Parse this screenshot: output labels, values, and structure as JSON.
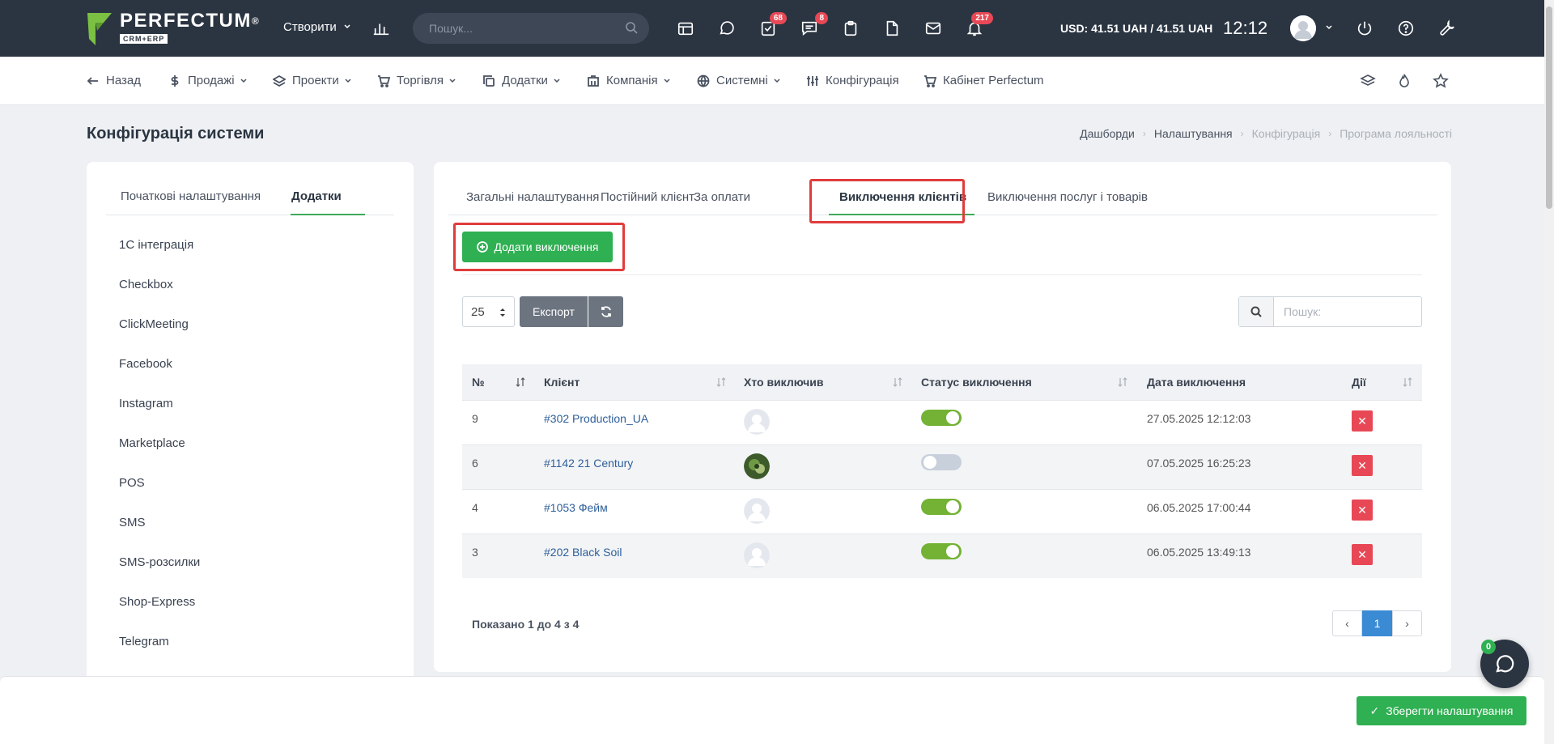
{
  "topbar": {
    "logo_name": "PERFECTUM",
    "logo_reg": "®",
    "logo_sub": "CRM+ERP",
    "create_label": "Створити",
    "search_placeholder": "Пошук...",
    "badges": {
      "tasks": "68",
      "messages": "8",
      "notifications": "217"
    },
    "currency": "USD: 41.51 UAH / 41.51 UAH",
    "time": "12:12"
  },
  "nav": {
    "back": "Назад",
    "sales": "Продажі",
    "projects": "Проекти",
    "trade": "Торгівля",
    "addons": "Додатки",
    "company": "Компанія",
    "system": "Системні",
    "config": "Конфігурація",
    "cabinet": "Кабінет Perfectum"
  },
  "page": {
    "title": "Конфігурація системи",
    "breadcrumb": [
      "Дашборди",
      "Налаштування",
      "Конфігурація",
      "Програма лояльності"
    ]
  },
  "left": {
    "tabs": [
      "Початкові налаштування",
      "Додатки"
    ],
    "items": [
      "1С інтеграція",
      "Checkbox",
      "ClickMeeting",
      "Facebook",
      "Instagram",
      "Marketplace",
      "POS",
      "SMS",
      "SMS-розсилки",
      "Shop-Express",
      "Telegram"
    ]
  },
  "right": {
    "tabs": [
      "Загальні налаштування",
      "Постійний клієнт",
      "За оплати",
      "Виключення клієнтів",
      "Виключення послуг і товарів"
    ],
    "add_button": "Додати виключення",
    "page_size": "25",
    "export": "Експорт",
    "search_placeholder": "Пошук:",
    "columns": [
      "№",
      "Клієнт",
      "Хто виключив",
      "Статус виключення",
      "Дата виключення",
      "Дії"
    ],
    "rows": [
      {
        "num": "9",
        "client": "#302 Production_UA",
        "status_on": true,
        "date": "27.05.2025 12:12:03"
      },
      {
        "num": "6",
        "client": "#1142 21 Century",
        "status_on": false,
        "date": "07.05.2025 16:25:23"
      },
      {
        "num": "4",
        "client": "#1053 Фейм",
        "status_on": true,
        "date": "06.05.2025 17:00:44"
      },
      {
        "num": "3",
        "client": "#202 Black Soil",
        "status_on": true,
        "date": "06.05.2025 13:49:13"
      }
    ],
    "showing": "Показано 1 до 4 з 4",
    "current_page": "1"
  },
  "footer": {
    "save": "Зберегти налаштування",
    "chat_badge": "0"
  },
  "colors": {
    "topbar": "#2b3542",
    "accent_green": "#2fb052",
    "highlight_red": "#e03c3c",
    "danger": "#e84855",
    "link": "#2d5f9a"
  }
}
